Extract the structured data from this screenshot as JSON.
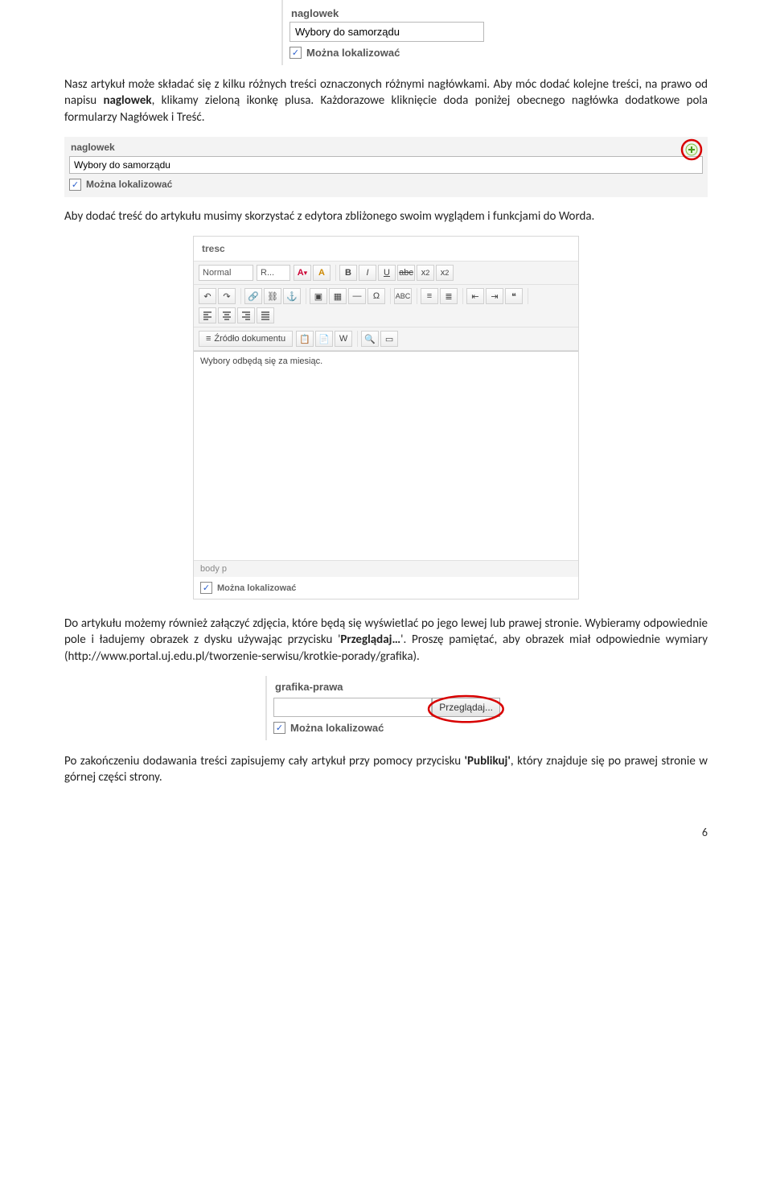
{
  "formlet1": {
    "label": "naglowek",
    "value": "Wybory do samorządu",
    "checkbox": {
      "checked": true,
      "label": "Można lokalizować"
    }
  },
  "para1_a": "Nasz artykuł może składać się z kilku różnych treści oznaczonych różnymi nagłówkami. Aby móc dodać kolejne treści, na prawo od napisu ",
  "para1_b": "naglowek",
  "para1_c": ", klikamy zieloną ikonkę plusa. Każdorazowe kliknięcie doda poniżej obecnego nagłówka dodatkowe pola formularzy Nagłówek i Treść.",
  "formlet2": {
    "label": "naglowek",
    "value": "Wybory do samorządu",
    "checkbox": {
      "checked": true,
      "label": "Można lokalizować"
    }
  },
  "para2": "Aby dodać treść do artykułu musimy skorzystać z edytora zbliżonego swoim wyglądem i funkcjami do Worda.",
  "editor": {
    "header": "tresc",
    "style_dd1": "Normal",
    "style_dd2": "R...",
    "source_btn": "Źródło dokumentu",
    "content": "Wybory odbędą się za miesiąc.",
    "status": "body  p",
    "checkbox": {
      "checked": true,
      "label": "Można lokalizować"
    }
  },
  "para3_a": "Do artykułu możemy również załączyć zdjęcia, które będą się wyświetlać po jego lewej lub prawej stronie. Wybieramy odpowiednie pole i ładujemy obrazek z dysku używając przycisku '",
  "para3_b": "Przeglądaj…",
  "para3_c": "'. Proszę pamiętać, aby obrazek miał odpowiednie wymiary (http://www.portal.uj.edu.pl/tworzenie-serwisu/krotkie-porady/grafika).",
  "formlet3": {
    "label": "grafika-prawa",
    "browse_btn": "Przeglądaj...",
    "checkbox": {
      "checked": true,
      "label": "Można lokalizować"
    }
  },
  "para4_a": "Po zakończeniu dodawania treści zapisujemy cały artykuł przy pomocy przycisku ",
  "para4_b": "Publikuj",
  "para4_c": ", który znajduje się po prawej stronie w górnej części strony.",
  "page_number": "6"
}
